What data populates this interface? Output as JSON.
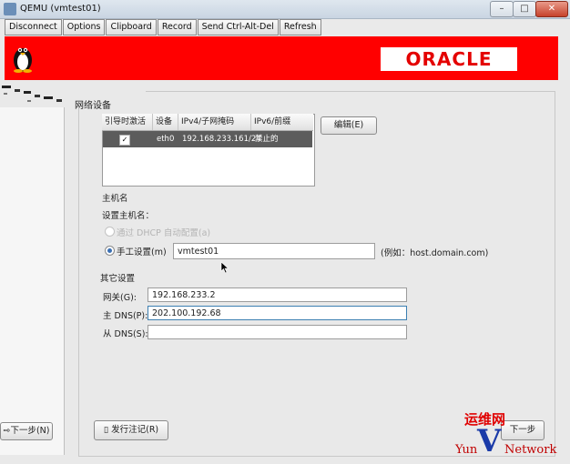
{
  "window": {
    "title": "QEMU (vmtest01)",
    "minimize": "–",
    "maximize": "□",
    "close": "✕"
  },
  "toolbar": {
    "items": [
      "Disconnect",
      "Options",
      "Clipboard",
      "Record",
      "Send Ctrl-Alt-Del",
      "Refresh"
    ]
  },
  "banner": {
    "logo_text": "ORACLE",
    "color": "#ff0000"
  },
  "section": {
    "title": "网络设备"
  },
  "table": {
    "headers": [
      "引导时激活",
      "设备",
      "IPv4/子网掩码",
      "IPv6/前缀"
    ],
    "rows": [
      {
        "active": "✓",
        "device": "eth0",
        "ipv4": "192.168.233.161/24",
        "ipv6": "禁止的"
      }
    ]
  },
  "edit_button": "编辑(E)",
  "hostname": {
    "section_title": "主机名",
    "set_label": "设置主机名：",
    "dhcp_label": "通过 DHCP 自动配置(a)",
    "manual_label": "手工设置(m)",
    "value": "vmtest01",
    "example": "(例如：host.domain.com)"
  },
  "other": {
    "section_title": "其它设置",
    "gateway_label": "网关(G):",
    "gateway_value": "192.168.233.2",
    "dns1_label": "主 DNS(P):",
    "dns1_value": "202.100.192.68",
    "dns2_label": "从 DNS(S):",
    "dns2_value": ""
  },
  "buttons": {
    "release_notes": "发行注记(R)",
    "next": "下一步(N)",
    "next_right": "下一步"
  },
  "watermark": {
    "cn": "运维网",
    "en_left": "Yun",
    "en_right": "Network",
    "letter": "V"
  }
}
